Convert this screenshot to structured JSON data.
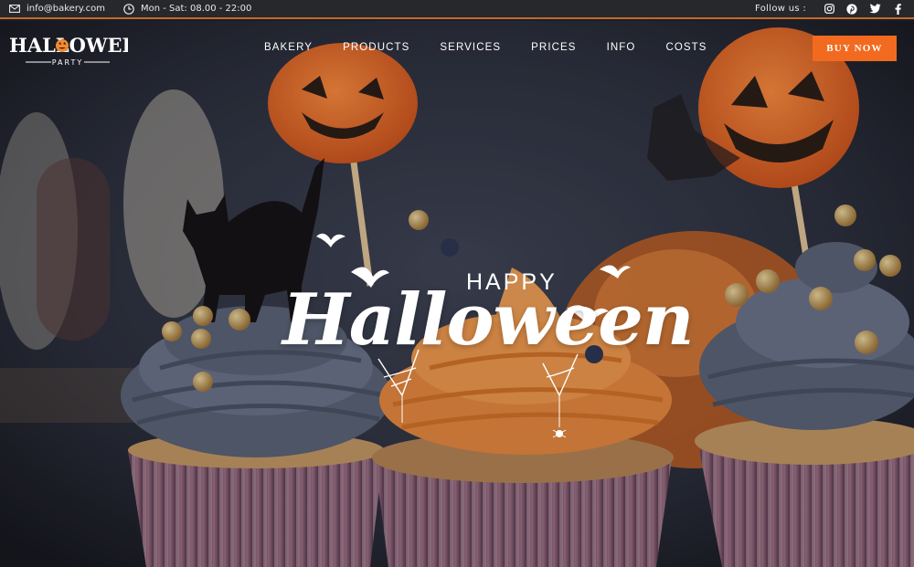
{
  "topbar": {
    "email": "info@bakery.com",
    "hours": "Mon - Sat: 08.00 - 22:00",
    "follow_label": "Follow us :",
    "social": [
      "instagram-icon",
      "pinterest-icon",
      "twitter-icon",
      "facebook-icon"
    ]
  },
  "logo": {
    "title": "HALLOWEEN",
    "subtitle": "PARTY"
  },
  "nav": {
    "items": [
      "BAKERY",
      "PRODUCTS",
      "SERVICES",
      "PRICES",
      "INFO",
      "COSTS"
    ]
  },
  "cta": {
    "label": "BUY NOW"
  },
  "hero": {
    "kicker": "HAPPY",
    "title": "Halloween"
  },
  "colors": {
    "topbar": "#27282b",
    "accent": "#f26a1f",
    "frosting_blue": "#5b6478",
    "frosting_orange": "#ec8a3e",
    "text": "#ffffff"
  }
}
